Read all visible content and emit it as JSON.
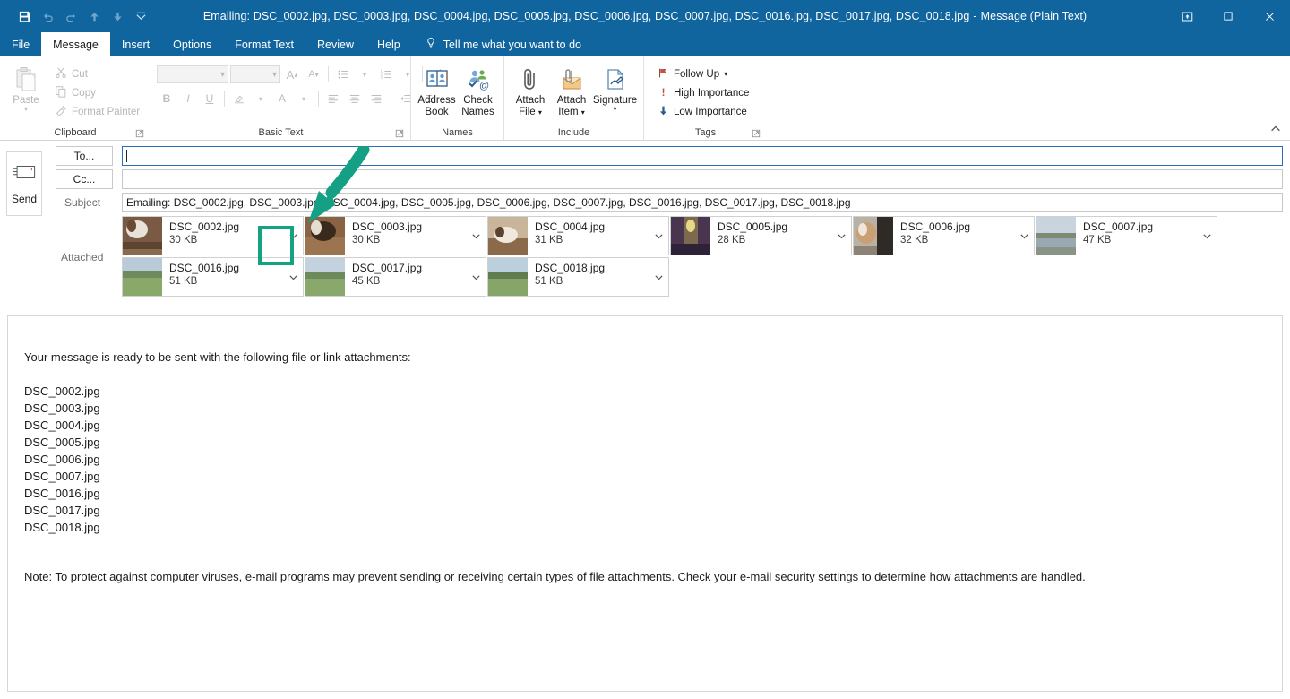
{
  "window": {
    "title_main": "Emailing: DSC_0002.jpg, DSC_0003.jpg, DSC_0004.jpg, DSC_0005.jpg, DSC_0006.jpg, DSC_0007.jpg, DSC_0016.jpg, DSC_0017.jpg, DSC_0018.jpg",
    "title_sep": "-",
    "title_suffix": "Message (Plain Text)",
    "accent_color": "#10659f",
    "highlight_color": "#13a383"
  },
  "quick_access": [
    {
      "name": "save-button",
      "icon": "save-icon",
      "enabled": true
    },
    {
      "name": "undo-button",
      "icon": "undo-icon",
      "enabled": false
    },
    {
      "name": "redo-button",
      "icon": "redo-icon",
      "enabled": false
    },
    {
      "name": "previous-item-button",
      "icon": "arrow-up-icon",
      "enabled": false
    },
    {
      "name": "next-item-button",
      "icon": "arrow-down-icon",
      "enabled": false
    },
    {
      "name": "customize-quick-access-toolbar-button",
      "icon": "chevron-down-icon",
      "enabled": true
    }
  ],
  "window_controls": [
    {
      "name": "ribbon-display-options-button",
      "label": "ribbon-display-options-icon"
    },
    {
      "name": "maximize-button",
      "label": "maximize-icon"
    },
    {
      "name": "close-button",
      "label": "close-icon"
    }
  ],
  "tabs": [
    {
      "label": "File",
      "active": false
    },
    {
      "label": "Message",
      "active": true
    },
    {
      "label": "Insert",
      "active": false
    },
    {
      "label": "Options",
      "active": false
    },
    {
      "label": "Format Text",
      "active": false
    },
    {
      "label": "Review",
      "active": false
    },
    {
      "label": "Help",
      "active": false
    }
  ],
  "tell_me": {
    "label": "Tell me what you want to do",
    "icon": "lightbulb-icon"
  },
  "ribbon": {
    "clipboard": {
      "group_label": "Clipboard",
      "paste_label": "Paste",
      "cut_label": "Cut",
      "copy_label": "Copy",
      "format_painter_label": "Format Painter"
    },
    "basic_text": {
      "group_label": "Basic Text",
      "font_name_value": "",
      "font_size_value": "",
      "grow_font_label": "A",
      "shrink_font_label": "A",
      "bold_label": "B",
      "italic_label": "I",
      "underline_label": "U",
      "font_color_label": "A"
    },
    "names": {
      "group_label": "Names",
      "address_book_line1": "Address",
      "address_book_line2": "Book",
      "check_names_line1": "Check",
      "check_names_line2": "Names"
    },
    "include": {
      "group_label": "Include",
      "attach_file_line1": "Attach",
      "attach_file_line2": "File",
      "attach_item_line1": "Attach",
      "attach_item_line2": "Item",
      "signature_line1": "Signature",
      "signature_line2": ""
    },
    "tags": {
      "group_label": "Tags",
      "follow_up_label": "Follow Up",
      "high_importance_label": "High Importance",
      "low_importance_label": "Low Importance"
    },
    "collapse_label": "collapse-ribbon-icon"
  },
  "compose": {
    "send_label": "Send",
    "to_button_label": "To...",
    "cc_button_label": "Cc...",
    "to_value": "",
    "cc_value": "",
    "subject_label": "Subject",
    "subject_value": "Emailing: DSC_0002.jpg, DSC_0003.jpg, DSC_0004.jpg, DSC_0005.jpg, DSC_0006.jpg, DSC_0007.jpg, DSC_0016.jpg, DSC_0017.jpg, DSC_0018.jpg",
    "attached_label": "Attached",
    "attachments": [
      {
        "name": "DSC_0002.jpg",
        "size": "30 KB",
        "thumb": "dog-indoor",
        "selected": true
      },
      {
        "name": "DSC_0003.jpg",
        "size": "30 KB",
        "thumb": "dog-floor",
        "selected": false
      },
      {
        "name": "DSC_0004.jpg",
        "size": "31 KB",
        "thumb": "dog-couch",
        "selected": false
      },
      {
        "name": "DSC_0005.jpg",
        "size": "28 KB",
        "thumb": "hallway",
        "selected": false
      },
      {
        "name": "DSC_0006.jpg",
        "size": "32 KB",
        "thumb": "dog-window",
        "selected": false
      },
      {
        "name": "DSC_0007.jpg",
        "size": "47 KB",
        "thumb": "lake",
        "selected": false
      },
      {
        "name": "DSC_0016.jpg",
        "size": "51 KB",
        "thumb": "field",
        "selected": false
      },
      {
        "name": "DSC_0017.jpg",
        "size": "45 KB",
        "thumb": "field",
        "selected": false
      },
      {
        "name": "DSC_0018.jpg",
        "size": "51 KB",
        "thumb": "field",
        "selected": false
      }
    ]
  },
  "body": {
    "intro": "Your message is ready to be sent with the following file or link attachments:",
    "files": [
      "DSC_0002.jpg",
      "DSC_0003.jpg",
      "DSC_0004.jpg",
      "DSC_0005.jpg",
      "DSC_0006.jpg",
      "DSC_0007.jpg",
      "DSC_0016.jpg",
      "DSC_0017.jpg",
      "DSC_0018.jpg"
    ],
    "note": "Note: To protect against computer viruses, e-mail programs may prevent sending or receiving certain types of file attachments.  Check your e-mail security settings to determine how attachments are handled."
  },
  "annotation": {
    "arrow_color": "#13a383",
    "highlight_target": "attachment-dropdown-chevron-0"
  }
}
